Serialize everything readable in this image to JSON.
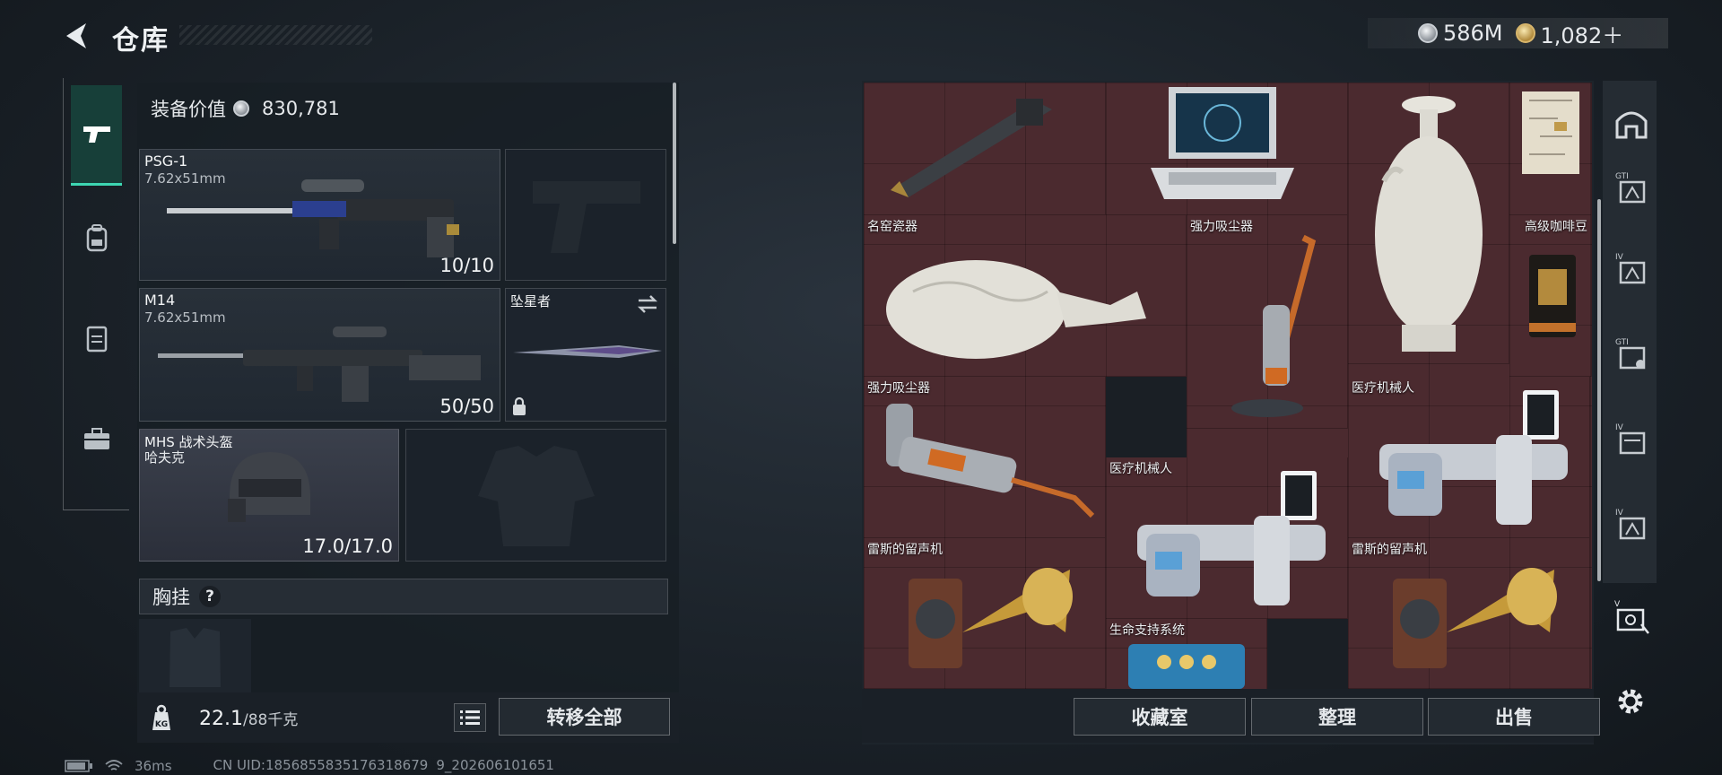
{
  "header": {
    "title": "仓库",
    "currency": [
      {
        "icon": "silver-coin-icon",
        "value": "586M"
      },
      {
        "icon": "gold-coin-icon",
        "value": "1,082＋"
      }
    ]
  },
  "equipment": {
    "value_label": "装备价值",
    "value": "830,781",
    "primary_weapon": {
      "name": "PSG-1",
      "caliber": "7.62x51mm",
      "ammo": "10/10"
    },
    "secondary_weapon": {
      "name": "M14",
      "caliber": "7.62x51mm",
      "ammo": "50/50"
    },
    "melee": {
      "name": "坠星者"
    },
    "helmet": {
      "name": "MHS 战术头盔",
      "sub": "哈夫克",
      "durability": "17.0/17.0"
    },
    "chest_rig_label": "胸挂",
    "help_glyph": "?",
    "weight_current": "22.1",
    "weight_max": "/88千克",
    "weight_icon_label": "KG",
    "transfer_all": "转移全部"
  },
  "storage": {
    "items": [
      {
        "label": "名窑瓷器"
      },
      {
        "label": "强力吸尘器"
      },
      {
        "label": "高级咖啡豆"
      },
      {
        "label": "强力吸尘器"
      },
      {
        "label": "医疗机械人"
      },
      {
        "label": "医疗机械人"
      },
      {
        "label": "雷斯的留声机"
      },
      {
        "label": "雷斯的留声机"
      },
      {
        "label": "生命支持系统"
      }
    ],
    "buttons": {
      "collection": "收藏室",
      "organize": "整理",
      "sell": "出售"
    }
  },
  "side_tabs": [
    "GTI",
    "IV",
    "GTI",
    "IV",
    "IV",
    "V"
  ],
  "status": {
    "ping": "36ms",
    "uid": "CN UID:18568558351763186799_202606101651"
  },
  "colors": {
    "accent": "#3dd6b2",
    "storage_bg": "#4b2a2f",
    "panel": "#1e252d"
  }
}
